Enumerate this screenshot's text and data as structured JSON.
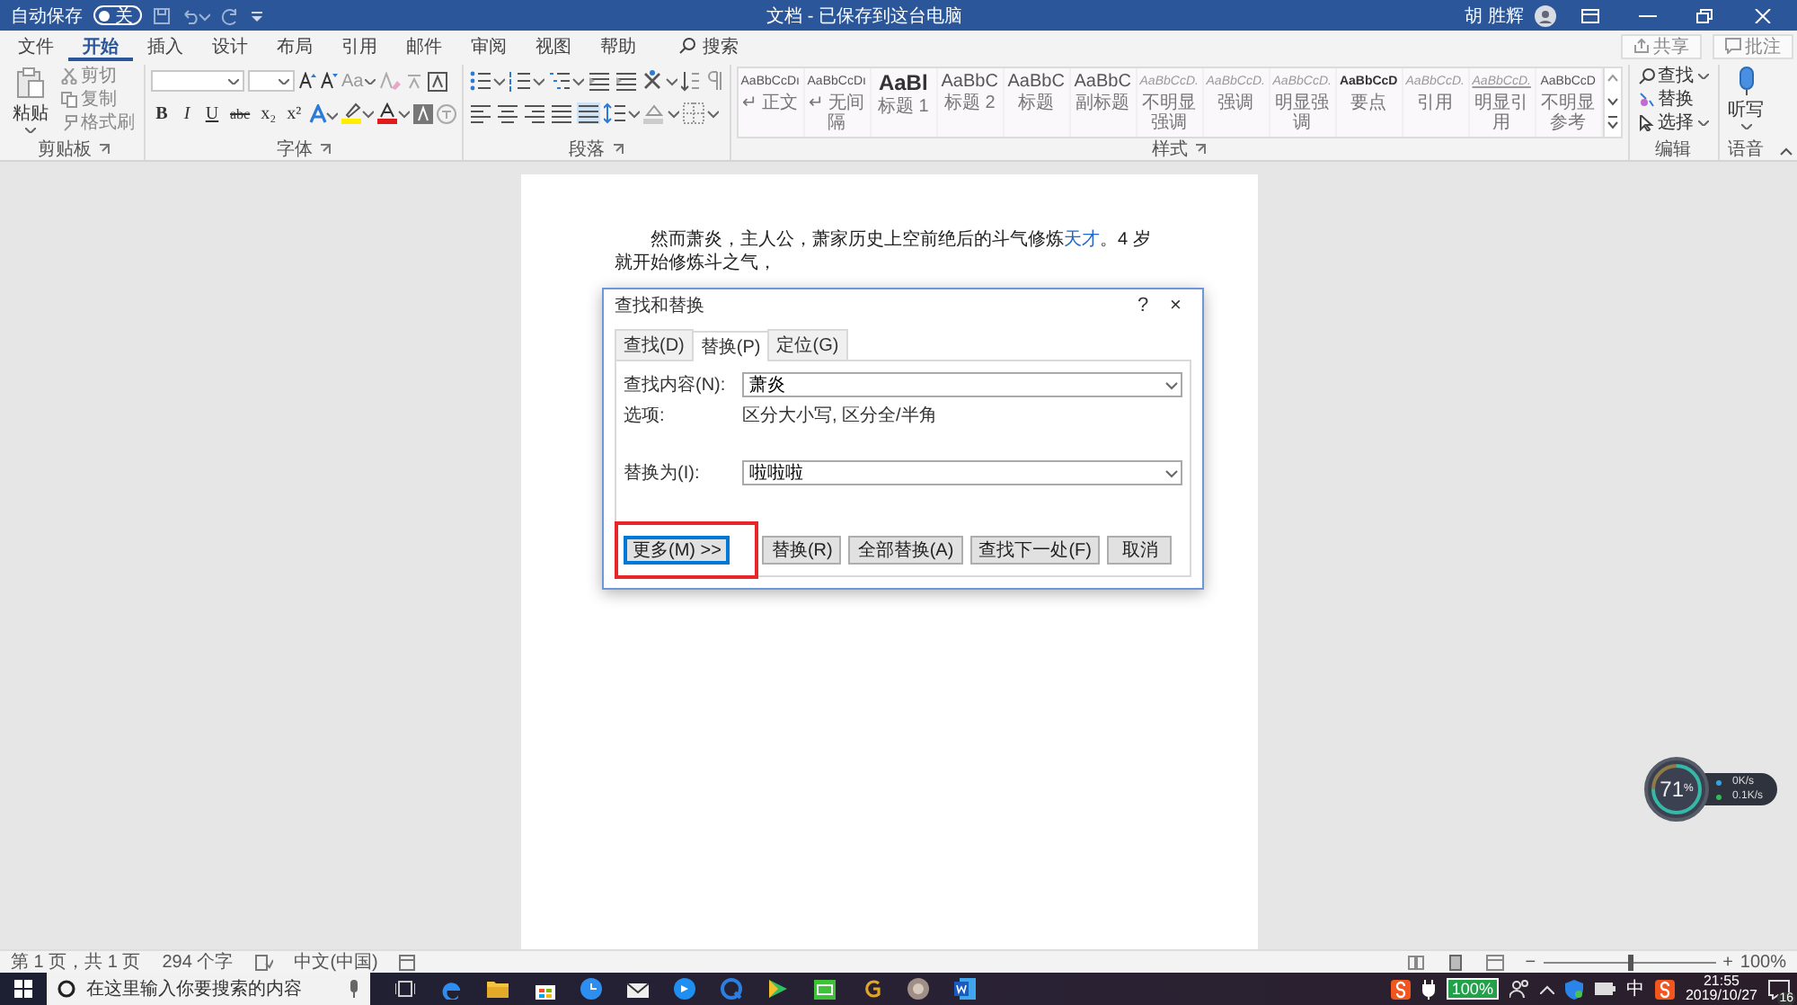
{
  "title_bar": {
    "autosave_label": "自动保存",
    "autosave": {
      "on": false,
      "label": "关"
    },
    "document_title": "文档 - 已保存到这台电脑",
    "user_name": "胡 胜辉"
  },
  "menu_tabs": [
    {
      "label": "文件",
      "selected": false
    },
    {
      "label": "开始",
      "selected": true
    },
    {
      "label": "插入",
      "selected": false
    },
    {
      "label": "设计",
      "selected": false
    },
    {
      "label": "布局",
      "selected": false
    },
    {
      "label": "引用",
      "selected": false
    },
    {
      "label": "邮件",
      "selected": false
    },
    {
      "label": "审阅",
      "selected": false
    },
    {
      "label": "视图",
      "selected": false
    },
    {
      "label": "帮助",
      "selected": false
    }
  ],
  "search": {
    "label": "搜索"
  },
  "share": "共享",
  "comments": "批注",
  "clipboard": {
    "paste": "粘贴",
    "cut": "剪切",
    "copy": "复制",
    "format_painter": "格式刷",
    "group_label": "剪贴板"
  },
  "font": {
    "format_buttons": [
      "B",
      "I",
      "U",
      "abc",
      "x₂",
      "x²"
    ],
    "change_case": "Aa",
    "group_label": "字体"
  },
  "paragraph": {
    "group_label": "段落"
  },
  "styles": {
    "group_label": "样式",
    "items": [
      {
        "preview": "AaBbCcDı",
        "name": "↵ 正文",
        "kind": "plain"
      },
      {
        "preview": "AaBbCcDı",
        "name": "↵ 无间隔",
        "kind": "plain"
      },
      {
        "preview": "AaBl",
        "name": "标题 1",
        "kind": "big"
      },
      {
        "preview": "AaBbC",
        "name": "标题 2",
        "kind": "large"
      },
      {
        "preview": "AaBbC",
        "name": "标题",
        "kind": "large"
      },
      {
        "preview": "AaBbC",
        "name": "副标题",
        "kind": "large"
      },
      {
        "preview": "AaBbCcD.",
        "name": "不明显强调",
        "kind": "italic"
      },
      {
        "preview": "AaBbCcD.",
        "name": "强调",
        "kind": "italic"
      },
      {
        "preview": "AaBbCcD.",
        "name": "明显强调",
        "kind": "italic"
      },
      {
        "preview": "AaBbCcD",
        "name": "要点",
        "kind": "bold"
      },
      {
        "preview": "AaBbCcD.",
        "name": "引用",
        "kind": "italic"
      },
      {
        "preview": "AaBbCcD.",
        "name": "明显引用",
        "kind": "underline"
      },
      {
        "preview": "AaBbCcD",
        "name": "不明显参考",
        "kind": "plain"
      }
    ]
  },
  "editing": {
    "find": "查找",
    "replace": "替换",
    "select": "选择",
    "group_label": "编辑"
  },
  "voice": {
    "dictate": "听写",
    "group_label": "语音"
  },
  "document": {
    "text_before": "然而萧炎，主人公，萧家历史上空前绝后的斗气修炼",
    "match": "天才",
    "text_after": "。4 岁就开始修炼斗之气，"
  },
  "dialog": {
    "title": "查找和替换",
    "help": "?",
    "close": "×",
    "tabs": [
      {
        "label": "查找(D)",
        "selected": false
      },
      {
        "label": "替换(P)",
        "selected": true
      },
      {
        "label": "定位(G)",
        "selected": false
      }
    ],
    "find_label": "查找内容(N):",
    "find_value": "萧炎",
    "options_label": "选项:",
    "options_value": "区分大小写, 区分全/半角",
    "replace_label": "替换为(I):",
    "replace_value": "啦啦啦",
    "more_button": {
      "label": "更多(M) >>",
      "annotated": true
    },
    "buttons": [
      "替换(R)",
      "全部替换(A)",
      "查找下一处(F)",
      "取消"
    ]
  },
  "status_bar": {
    "page": "第 1 页，共 1 页",
    "words": "294 个字",
    "language": "中文(中国)",
    "zoom_out": "−",
    "zoom_in": "+",
    "zoom": {
      "level": 0.5
    },
    "zoom_label": "100%"
  },
  "taskbar": {
    "search_placeholder": "在这里输入你要搜索的内容",
    "battery": "100%",
    "ime": "中",
    "time": "21:55",
    "date": "2019/10/27",
    "notifications": "16"
  },
  "monitor_widget": {
    "cpu": "71",
    "cpu_unit": "%",
    "upload": "0K/s",
    "download": "0.1K/s"
  }
}
